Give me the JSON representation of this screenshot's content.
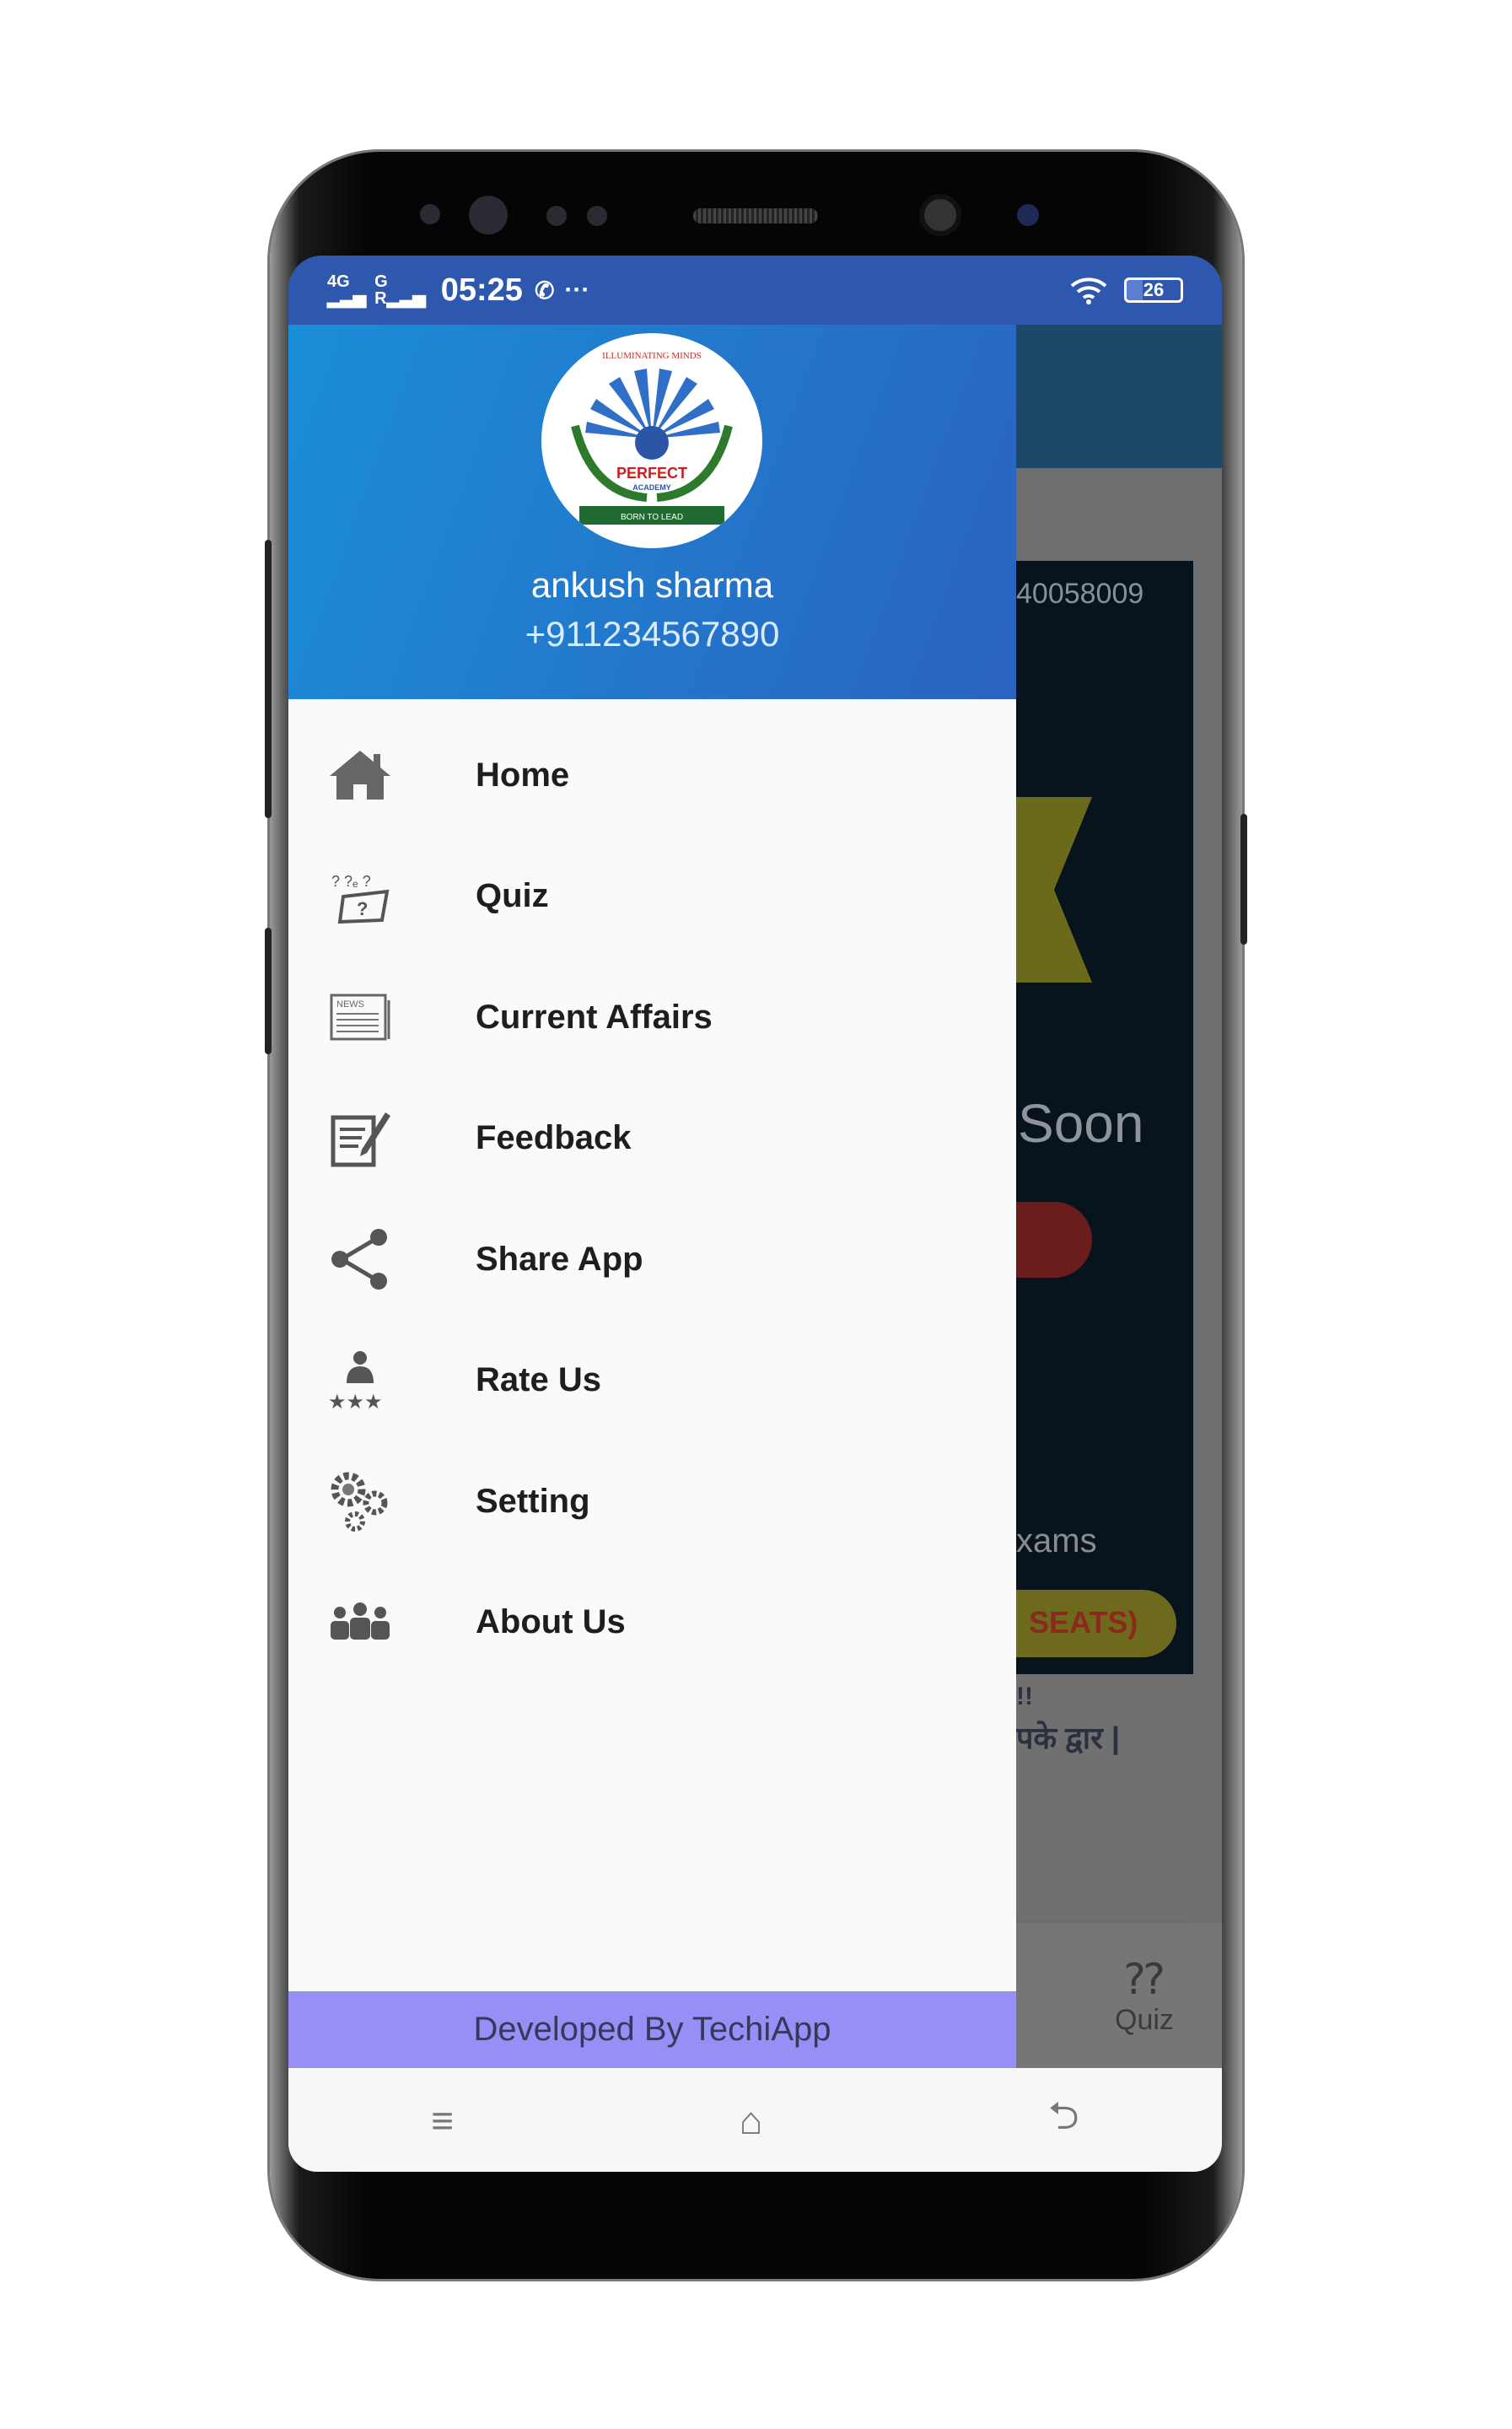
{
  "status_bar": {
    "network": "4G",
    "network2": "G",
    "time": "05:25",
    "battery": "26",
    "icons": [
      "signal-icon",
      "whatsapp-icon",
      "more-icon",
      "wifi-icon",
      "battery-icon"
    ]
  },
  "drawer": {
    "user_name": "ankush sharma",
    "user_phone": "+911234567890",
    "logo": {
      "top_text": "ILLUMINATING MINDS",
      "name": "PERFECT ACADEMY",
      "ribbon": "BORN TO LEAD"
    },
    "items": [
      {
        "label": "Home",
        "icon": "home-icon"
      },
      {
        "label": "Quiz",
        "icon": "quiz-icon"
      },
      {
        "label": "Current Affairs",
        "icon": "newspaper-icon"
      },
      {
        "label": "Feedback",
        "icon": "feedback-icon"
      },
      {
        "label": "Share App",
        "icon": "share-icon"
      },
      {
        "label": "Rate Us",
        "icon": "rate-icon"
      },
      {
        "label": "Setting",
        "icon": "gears-icon"
      },
      {
        "label": "About Us",
        "icon": "group-icon"
      }
    ],
    "footer": "Developed By TechiApp"
  },
  "background": {
    "phone_fragment": "40058009",
    "soon": "Soon",
    "exams": "xams",
    "seats": "SEATS)",
    "hindi1": "!!",
    "hindi2": "पके द्वार |",
    "tab_quiz": "Quiz"
  },
  "nav": {
    "menu": "≡",
    "home": "⌂",
    "back": "⮌"
  }
}
